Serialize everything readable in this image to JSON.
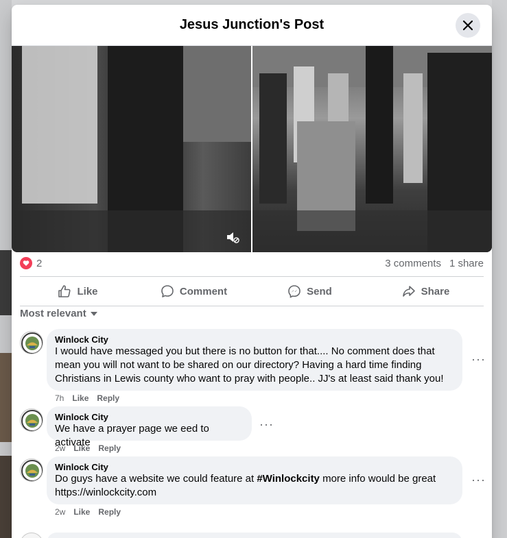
{
  "post": {
    "title": "Jesus Junction's Post",
    "reaction_count": "2",
    "comments_count": "3 comments",
    "shares_count": "1 share"
  },
  "actions": {
    "like": "Like",
    "comment": "Comment",
    "send": "Send",
    "share": "Share"
  },
  "sort_label": "Most relevant",
  "comments": [
    {
      "author": "Winlock City",
      "lines": [
        "I would have messaged you but there is no button for that.... No comment does that",
        "mean you will not want to be shared on our directory? Having a hard time finding",
        "Christians in Lewis county who want to pray with people.. JJ's at least said thank you!"
      ],
      "time": "7h",
      "like": "Like",
      "reply": "Reply"
    },
    {
      "author": "Winlock City",
      "lines": [
        "We have a prayer page we eed to activate"
      ],
      "time": "2w",
      "like": "Like",
      "reply": "Reply"
    },
    {
      "author": "Winlock City",
      "line1_before": "Do guys have a website we could feature at ",
      "hashtag": "#Winlockcity",
      "line1_after": " more info would be great",
      "line2": "https://winlockcity.com",
      "time": "2w",
      "like": "Like",
      "reply": "Reply"
    }
  ],
  "colors": {
    "heart": "#f33e58",
    "muted_text": "#65676b",
    "bubble_bg": "#f0f2f5"
  }
}
